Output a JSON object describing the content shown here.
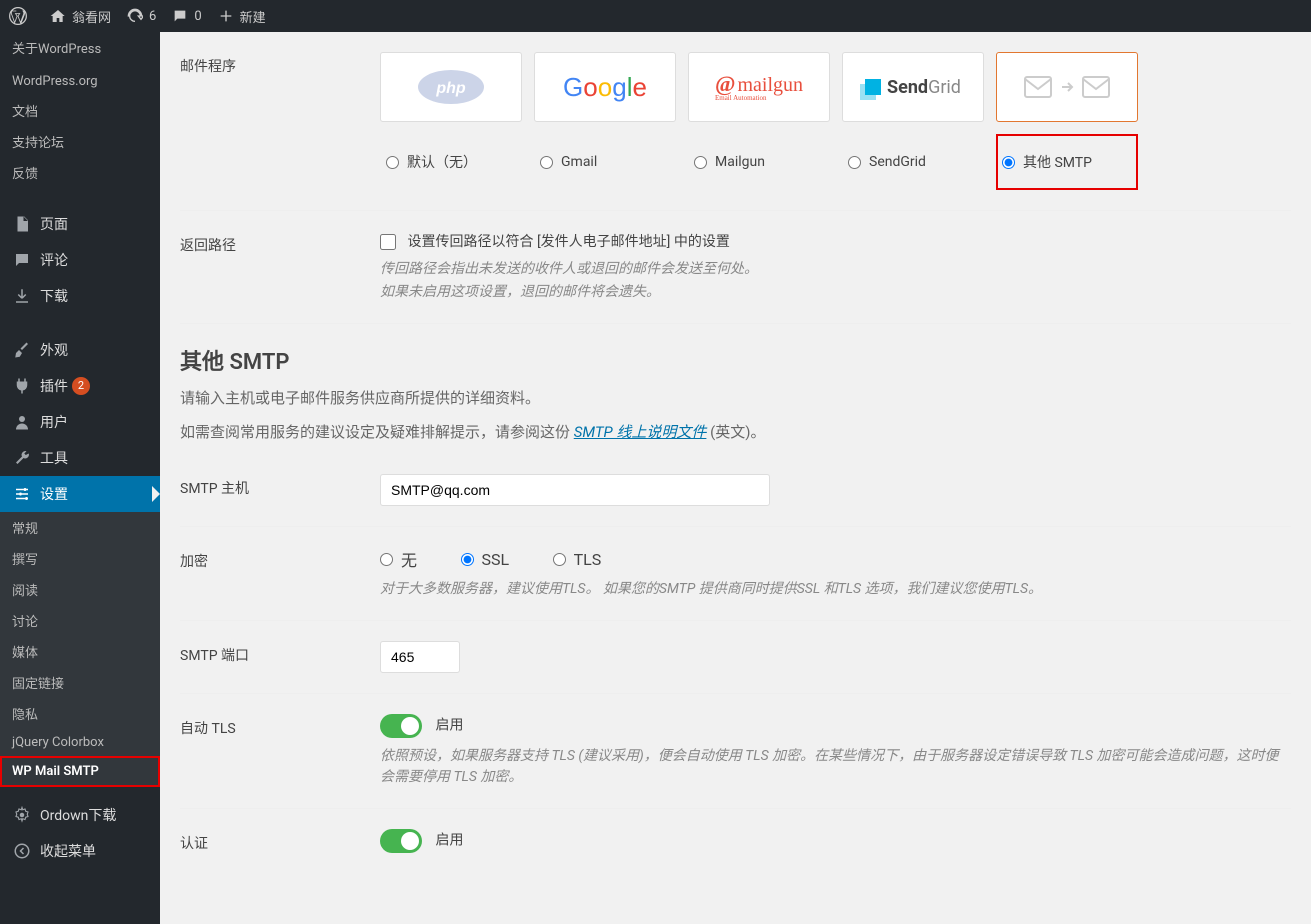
{
  "topbar": {
    "site_name": "翁看网",
    "updates_count": "6",
    "comments_count": "0",
    "new_label": "新建"
  },
  "sidebar": {
    "about": "关于WordPress",
    "wp_org": "WordPress.org",
    "docs": "文档",
    "support": "支持论坛",
    "feedback": "反馈",
    "pages": "页面",
    "comments": "评论",
    "downloads": "下载",
    "appearance": "外观",
    "plugins": "插件",
    "plugins_badge": "2",
    "users": "用户",
    "tools": "工具",
    "settings": "设置",
    "general": "常规",
    "writing": "撰写",
    "reading": "阅读",
    "discussion": "讨论",
    "media": "媒体",
    "permalinks": "固定链接",
    "privacy": "隐私",
    "jquery_colorbox": "jQuery Colorbox",
    "wp_mail_smtp": "WP Mail SMTP",
    "ordown": "Ordown下载",
    "collapse": "收起菜单"
  },
  "mailer": {
    "label": "邮件程序",
    "opt_default": "默认（无）",
    "opt_gmail": "Gmail",
    "opt_mailgun": "Mailgun",
    "opt_sendgrid": "SendGrid",
    "opt_other": "其他 SMTP"
  },
  "return_path": {
    "label": "返回路径",
    "checkbox_label": "设置传回路径以符合 [发件人电子邮件地址] 中的设置",
    "desc1": "传回路径会指出未发送的收件人或退回的邮件会发送至何处。",
    "desc2": "如果未启用这项设置，退回的邮件将会遗失。"
  },
  "section": {
    "title": "其他 SMTP",
    "subtitle": "请输入主机或电子邮件服务供应商所提供的详细资料。",
    "help_prefix": "如需查阅常用服务的建议设定及疑难排解提示，请参阅这份 ",
    "help_link": "SMTP 线上说明文件",
    "help_suffix": " (英文)。"
  },
  "smtp_host": {
    "label": "SMTP 主机",
    "value": "SMTP@qq.com"
  },
  "encryption": {
    "label": "加密",
    "none": "无",
    "ssl": "SSL",
    "tls": "TLS",
    "desc": "对于大多数服务器，建议使用TLS。 如果您的SMTP 提供商同时提供SSL 和TLS 选项，我们建议您使用TLS。"
  },
  "smtp_port": {
    "label": "SMTP 端口",
    "value": "465"
  },
  "auto_tls": {
    "label": "自动 TLS",
    "on_label": "启用",
    "desc": "依照预设，如果服务器支持 TLS (建议采用)，便会自动使用 TLS 加密。在某些情况下，由于服务器设定错误导致 TLS 加密可能会造成问题，这时便会需要停用 TLS 加密。"
  },
  "auth": {
    "label": "认证",
    "on_label": "启用"
  }
}
